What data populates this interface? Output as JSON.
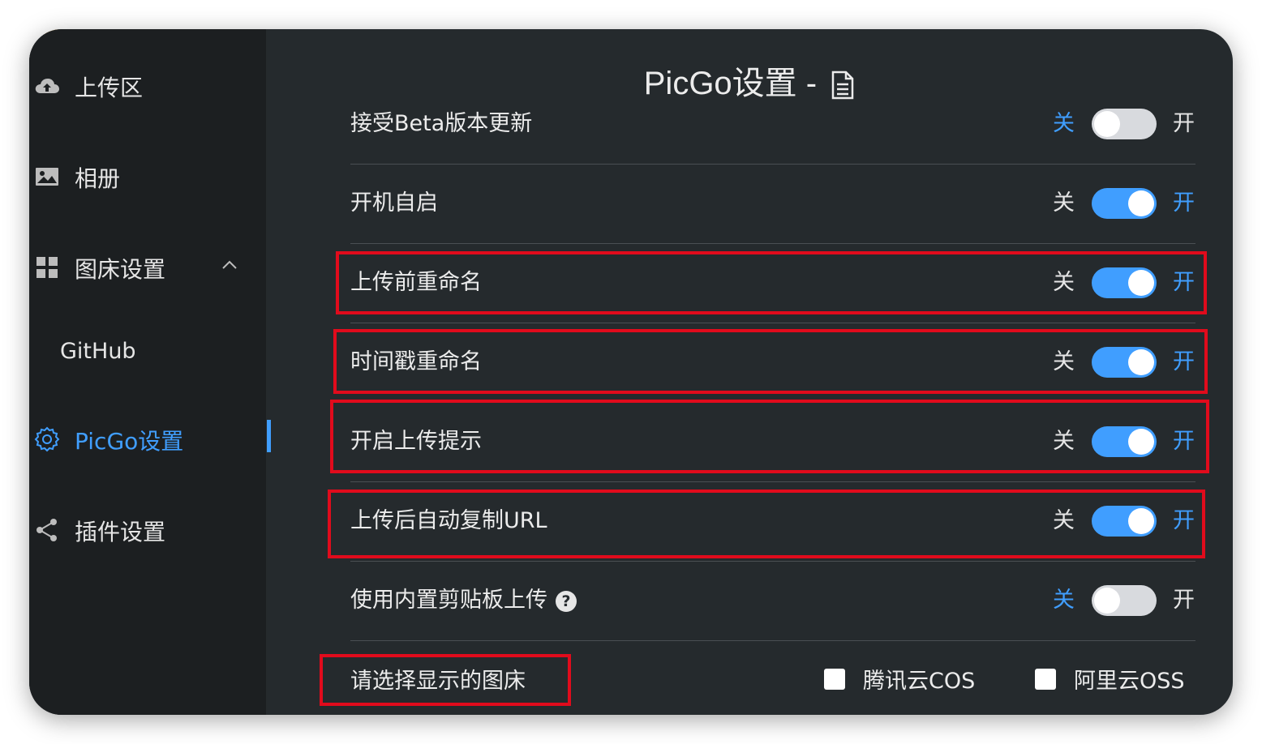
{
  "sidebar": {
    "items": [
      {
        "label": "上传区"
      },
      {
        "label": "相册"
      },
      {
        "label": "图床设置"
      },
      {
        "label": "GitHub"
      },
      {
        "label": "PicGo设置"
      },
      {
        "label": "插件设置"
      }
    ]
  },
  "header": {
    "title": "PicGo设置 -"
  },
  "settings": {
    "off_text": "关",
    "on_text": "开",
    "rows": [
      {
        "label": "接受Beta版本更新",
        "enabled": false
      },
      {
        "label": "开机自启",
        "enabled": true
      },
      {
        "label": "上传前重命名",
        "enabled": true
      },
      {
        "label": "时间戳重命名",
        "enabled": true
      },
      {
        "label": "开启上传提示",
        "enabled": true
      },
      {
        "label": "上传后自动复制URL",
        "enabled": true
      },
      {
        "label": "使用内置剪贴板上传",
        "enabled": false
      }
    ],
    "picbed_label": "请选择显示的图床",
    "picbeds": [
      {
        "label": "腾讯云COS",
        "checked": false
      },
      {
        "label": "阿里云OSS",
        "checked": false
      }
    ]
  },
  "colors": {
    "accent": "#409eff",
    "highlight": "#e10b1c",
    "sidebar_bg": "#1c1f21",
    "content_bg": "#252a2d"
  }
}
